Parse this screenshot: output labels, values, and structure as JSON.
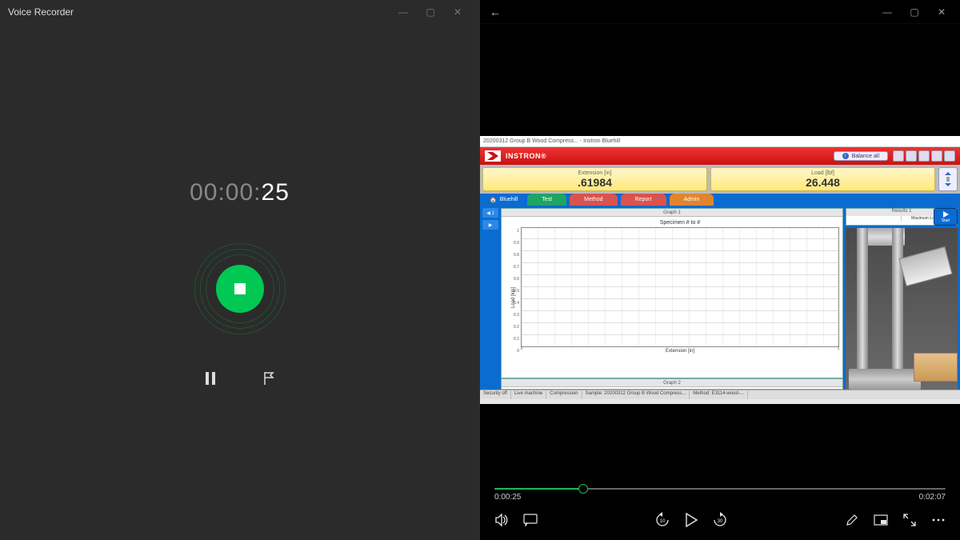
{
  "voice_recorder": {
    "title": "Voice Recorder",
    "timer_prefix": "00:00:",
    "timer_seconds": "25",
    "buttons": {
      "pause": "Pause",
      "flag": "Add marker",
      "stop": "Stop recording"
    },
    "window_controls": {
      "min": "—",
      "max": "▢",
      "close": "✕"
    }
  },
  "video_player": {
    "window_controls": {
      "back": "←",
      "min": "—",
      "max": "▢",
      "close": "✕"
    },
    "position": "0:00:25",
    "duration": "0:02:07",
    "progress_percent": 19.7,
    "controls": {
      "volume": "Volume",
      "subtitles": "Subtitles",
      "skip_back": "Skip back 10s",
      "play": "Play",
      "skip_fwd": "Skip forward 30s",
      "edit": "Edit",
      "mini": "Mini view",
      "fullscreen": "Fullscreen",
      "more": "More"
    }
  },
  "instron": {
    "window_title": "20200312 Group B Wood Compress... - Instron Bluehill",
    "brand": "INSTRON®",
    "balance_btn": "Balance all",
    "readouts": [
      {
        "label": "Extension [in]",
        "value": ".61984"
      },
      {
        "label": "Load [lbf]",
        "value": "26.448"
      }
    ],
    "tabs": {
      "home": "Bluehill",
      "test": "Test",
      "method": "Method",
      "report": "Report",
      "admin": "Admin"
    },
    "graph1_title": "Graph 1",
    "graph2_title": "Graph 2",
    "specimen_title": "Specimen # to #",
    "results_title": "Results 1",
    "results_col": "Maximum Load [lbf]",
    "start_btn": "Start",
    "chart_data": {
      "type": "line",
      "title": "Specimen # to #",
      "xlabel": "Extension [in]",
      "ylabel": "Load [kip]",
      "xlim": [
        0,
        1
      ],
      "ylim": [
        0,
        1
      ],
      "yticks": [
        0.0,
        0.1,
        0.2,
        0.3,
        0.4,
        0.5,
        0.6,
        0.7,
        0.8,
        0.9,
        1.0
      ],
      "xticks": [
        0,
        1
      ],
      "series": []
    },
    "status": {
      "security": "Security off",
      "machine": "Live machine",
      "mode": "Compression",
      "sample": "Sample: 20200312 Group B Wood Compress...",
      "method": "Method: E3114-wood-..."
    }
  }
}
